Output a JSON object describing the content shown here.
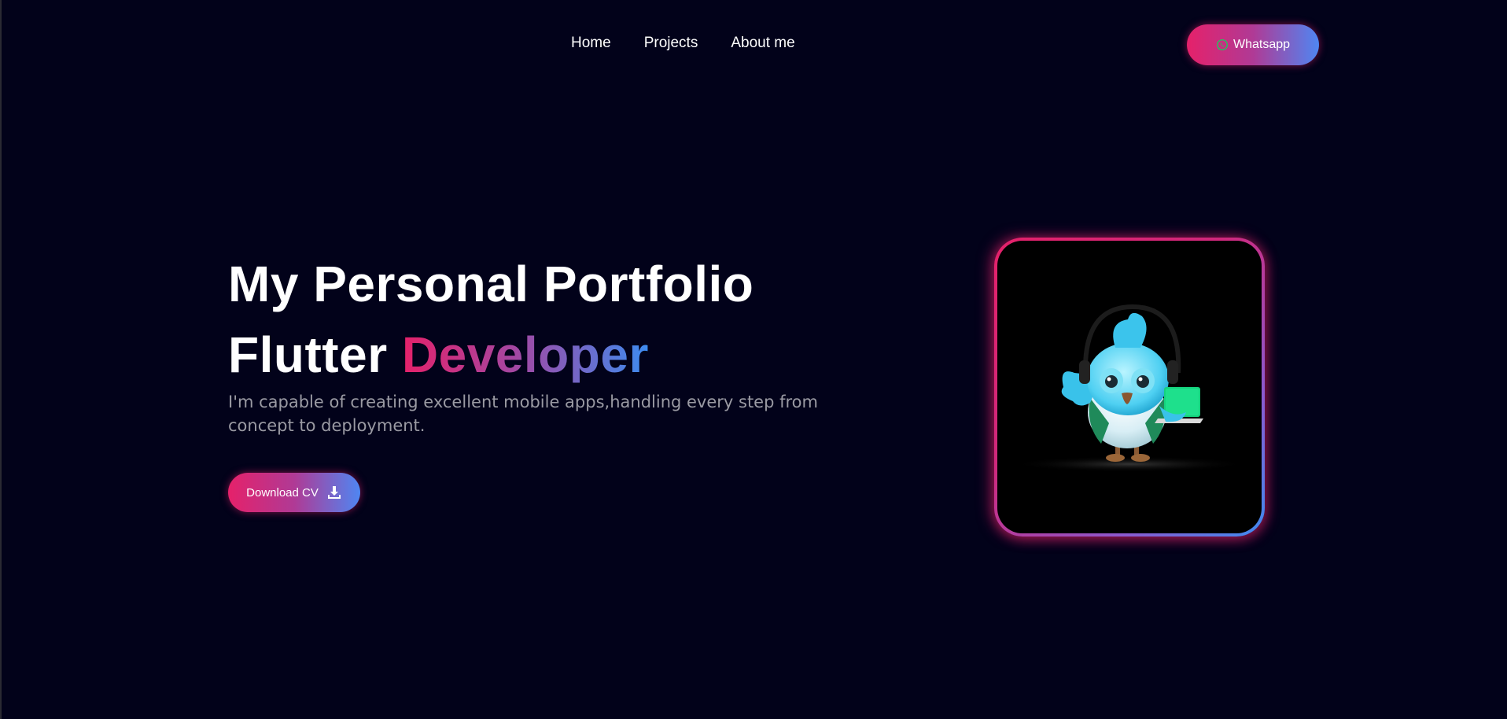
{
  "nav": {
    "items": [
      {
        "label": "Home"
      },
      {
        "label": "Projects"
      },
      {
        "label": "About me"
      }
    ],
    "whatsapp_label": "Whatsapp",
    "whatsapp_icon": "whatsapp-icon"
  },
  "hero": {
    "title": "My Personal Portfolio",
    "subtitle_plain": "Flutter ",
    "subtitle_highlight": "Developer",
    "description": "I'm capable of creating excellent mobile apps,handling every step from concept to deployment.",
    "cta_label": "Download CV",
    "cta_icon": "download-icon"
  },
  "image": {
    "subject": "dash-mascot-illustration"
  },
  "colors": {
    "background": "#02021a",
    "gradient_start": "#e5216a",
    "gradient_mid": "#a546a1",
    "gradient_end": "#3d8cf0",
    "text_primary": "#ffffff",
    "text_muted": "#9a9aa3"
  }
}
